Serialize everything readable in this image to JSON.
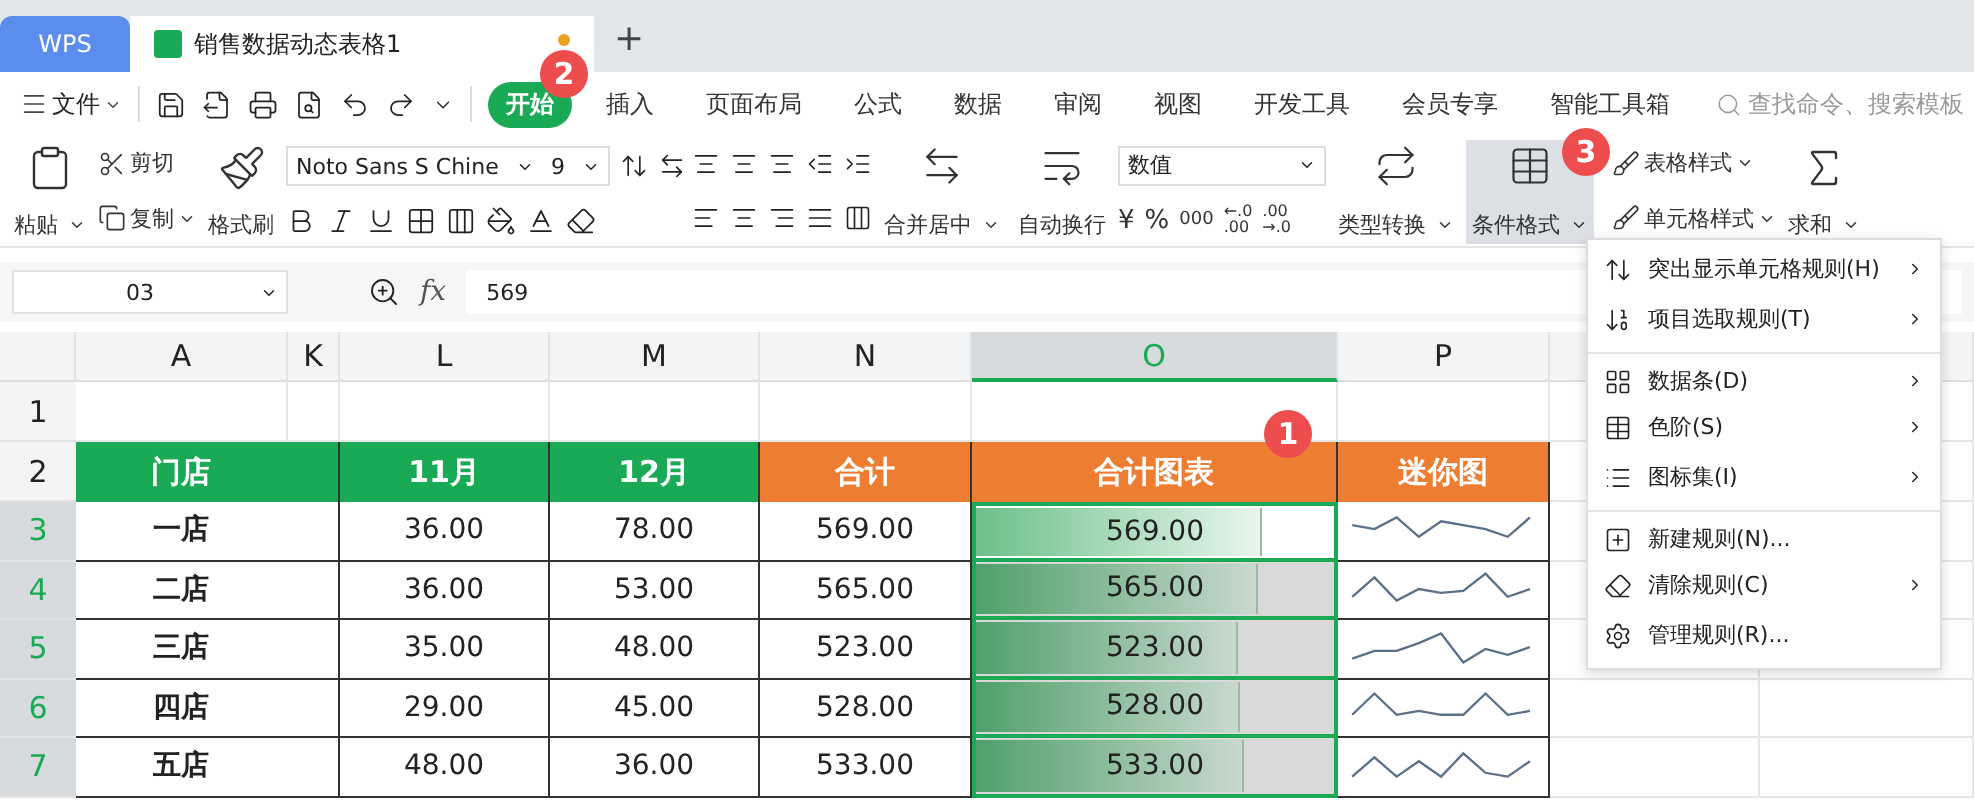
{
  "title_bar": {
    "app_tab": "WPS",
    "document_tab": {
      "title": "销售数据动态表格1",
      "unsaved": true
    },
    "new_tab": "+"
  },
  "menu_bar": {
    "file_menu": "文件",
    "tabs": [
      {
        "label": "开始",
        "selected": true
      },
      {
        "label": "插入",
        "selected": false
      },
      {
        "label": "页面布局",
        "selected": false
      },
      {
        "label": "公式",
        "selected": false
      },
      {
        "label": "数据",
        "selected": false
      },
      {
        "label": "审阅",
        "selected": false
      },
      {
        "label": "视图",
        "selected": false
      },
      {
        "label": "开发工具",
        "selected": false
      },
      {
        "label": "会员专享",
        "selected": false
      },
      {
        "label": "智能工具箱",
        "selected": false
      }
    ],
    "search": {
      "placeholder": "查找命令、搜索模板"
    }
  },
  "ribbon": {
    "paste": "粘贴",
    "cut": "剪切",
    "copy": "复制",
    "format_painter": "格式刷",
    "font": {
      "name": "Noto Sans S Chine",
      "size": "9"
    },
    "merge_center": "合并居中",
    "wrap_text": "自动换行",
    "number_format": "数值",
    "number_buttons": [
      {
        "kind": "symbol",
        "label": "¥"
      },
      {
        "kind": "symbol",
        "label": "%"
      },
      {
        "kind": "symbol",
        "label": "000"
      },
      {
        "kind": "stacked",
        "top": "←.0",
        "bottom": ".00"
      },
      {
        "kind": "stacked",
        "top": ".00",
        "bottom": "→.0"
      }
    ],
    "type_convert": "类型转换",
    "conditional_format": {
      "label": "条件格式",
      "open": true
    },
    "table_style": "表格样式",
    "cell_style": "单元格样式",
    "sum": "求和"
  },
  "formula_bar": {
    "name_box": "03",
    "fx_label": "fx",
    "formula": "569"
  },
  "sheet": {
    "columns": [
      {
        "label": "A",
        "selected": false
      },
      {
        "label": "K",
        "selected": false
      },
      {
        "label": "L",
        "selected": false
      },
      {
        "label": "M",
        "selected": false
      },
      {
        "label": "N",
        "selected": false
      },
      {
        "label": "O",
        "selected": true
      },
      {
        "label": "P",
        "selected": false
      }
    ],
    "blank_row": {
      "number": "1",
      "selected": false
    },
    "header_row": {
      "number": "2",
      "selected": false,
      "cells": [
        {
          "text": "门店",
          "color": "#1aaa55"
        },
        {
          "text": "11月",
          "color": "#1aaa55"
        },
        {
          "text": "12月",
          "color": "#1aaa55"
        },
        {
          "text": "合计",
          "color": "#ed7d31"
        },
        {
          "text": "合计图表",
          "color": "#ed7d31"
        },
        {
          "text": "迷你图",
          "color": "#ed7d31"
        }
      ]
    },
    "rows": [
      {
        "number": "3",
        "selected": true,
        "store": "一店",
        "nov": "36.00",
        "dec": "78.00",
        "total": "569.00",
        "bar": {
          "value": "569.00",
          "level": 0.8,
          "active": true
        }
      },
      {
        "number": "4",
        "selected": true,
        "store": "二店",
        "nov": "36.00",
        "dec": "53.00",
        "total": "565.00",
        "bar": {
          "value": "565.00",
          "level": 0.79,
          "active": false
        }
      },
      {
        "number": "5",
        "selected": true,
        "store": "三店",
        "nov": "35.00",
        "dec": "48.00",
        "total": "523.00",
        "bar": {
          "value": "523.00",
          "level": 0.73,
          "active": false
        }
      },
      {
        "number": "6",
        "selected": true,
        "store": "四店",
        "nov": "29.00",
        "dec": "45.00",
        "total": "528.00",
        "bar": {
          "value": "528.00",
          "level": 0.74,
          "active": false
        }
      },
      {
        "number": "7",
        "selected": true,
        "store": "五店",
        "nov": "48.00",
        "dec": "36.00",
        "total": "533.00",
        "bar": {
          "value": "533.00",
          "level": 0.75,
          "active": false
        }
      }
    ]
  },
  "conditional_format_menu": [
    {
      "label": "突出显示单元格规则(H)",
      "submenu": true,
      "group_start": false
    },
    {
      "label": "项目选取规则(T)",
      "submenu": true,
      "group_start": false
    },
    {
      "label": "数据条(D)",
      "submenu": true,
      "group_start": true
    },
    {
      "label": "色阶(S)",
      "submenu": true,
      "group_start": false
    },
    {
      "label": "图标集(I)",
      "submenu": true,
      "group_start": false
    },
    {
      "label": "新建规则(N)...",
      "submenu": false,
      "group_start": true
    },
    {
      "label": "清除规则(C)",
      "submenu": true,
      "group_start": false
    },
    {
      "label": "管理规则(R)...",
      "submenu": false,
      "group_start": false
    }
  ],
  "callouts": [
    "1",
    "2",
    "3"
  ]
}
